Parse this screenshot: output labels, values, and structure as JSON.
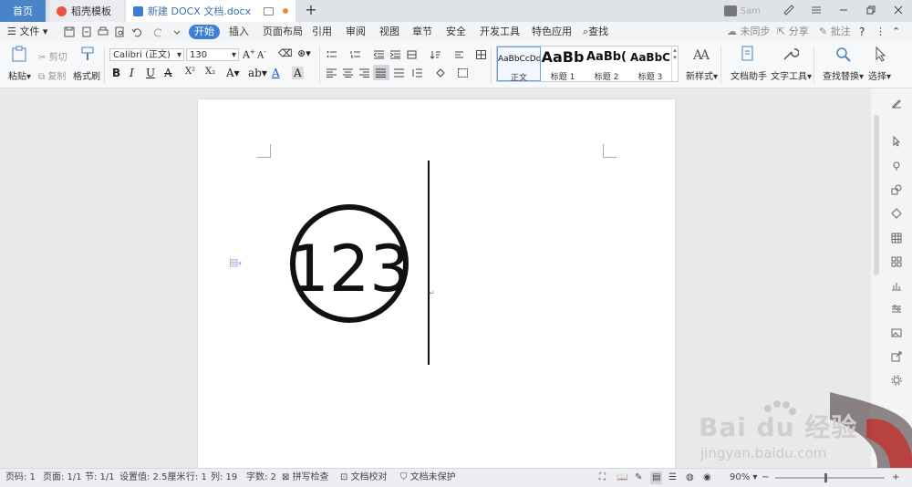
{
  "titlebar": {
    "tabs": [
      "首页",
      "稻壳模板",
      "新建 DOCX 文档.docx"
    ],
    "new_tab": "+",
    "user": "Sam"
  },
  "menubar": {
    "file": "文件",
    "items": [
      "开始",
      "插入",
      "页面布局",
      "引用",
      "审阅",
      "视图",
      "章节",
      "安全",
      "开发工具",
      "特色应用",
      "查找"
    ],
    "right": [
      "未同步",
      "分享",
      "批注"
    ],
    "help": "?"
  },
  "ribbon": {
    "paste": "粘贴",
    "cut": "剪切",
    "copy": "复制",
    "format_painter": "格式刷",
    "font_name": "Calibri (正文)",
    "font_size": "130",
    "bold": "B",
    "italic": "I",
    "underline": "U",
    "styles": [
      {
        "preview": "AaBbCcDd",
        "name": "正文"
      },
      {
        "preview": "AaBb",
        "name": "标题 1"
      },
      {
        "preview": "AaBb(",
        "name": "标题 2"
      },
      {
        "preview": "AaBbC",
        "name": "标题 3"
      }
    ],
    "new_style": "新样式",
    "doc_helper": "文档助手",
    "text_tools": "文字工具",
    "find_replace": "查找替换",
    "select": "选择"
  },
  "document": {
    "circled_text": "123"
  },
  "status": {
    "page_code": "页码: 1",
    "page": "页面: 1/1",
    "section": "节: 1/1",
    "setting": "设置值: 2.5厘米",
    "row": "行: 1",
    "col": "列: 19",
    "word_count": "字数: 2",
    "spell_check": "拼写检查",
    "doc_proof": "文档校对",
    "doc_protect": "文档未保护",
    "zoom": "90%"
  },
  "watermark": {
    "brand": "Bai du 经验",
    "url": "jingyan.baidu.com"
  },
  "colors": {
    "accent": "#3f7fd7",
    "home_tab": "#4a84c8",
    "doc_tab_text": "#3a6fb0",
    "status_bg": "#eceef1"
  }
}
